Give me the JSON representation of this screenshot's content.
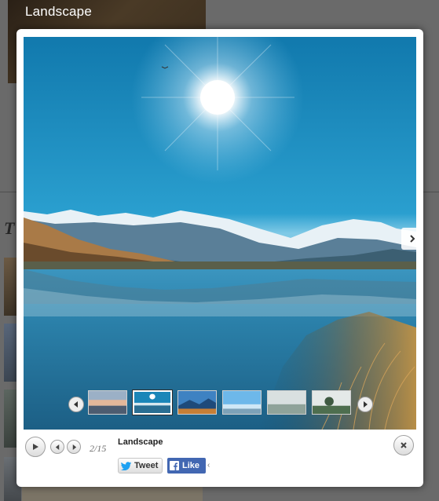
{
  "background_page": {
    "banner_title": "Landscape",
    "heading_fragment": "T"
  },
  "lightbox": {
    "caption": {
      "title": "Landscape",
      "counter": "2/15"
    },
    "social": {
      "tweet_label": "Tweet",
      "like_label": "Like",
      "like_arrow": "‹"
    },
    "thumbnails": [
      {
        "icon": "thumb-sunset-clouds",
        "active": false
      },
      {
        "icon": "thumb-sun-lake",
        "active": true
      },
      {
        "icon": "thumb-blue-mountains",
        "active": false
      },
      {
        "icon": "thumb-sky-horizon",
        "active": false
      },
      {
        "icon": "thumb-misty-field",
        "active": false
      },
      {
        "icon": "thumb-tree-fog",
        "active": false
      }
    ]
  },
  "colors": {
    "like_blue": "#4267b2",
    "twitter_blue": "#1da1f2",
    "sky": "#1b86b8"
  }
}
